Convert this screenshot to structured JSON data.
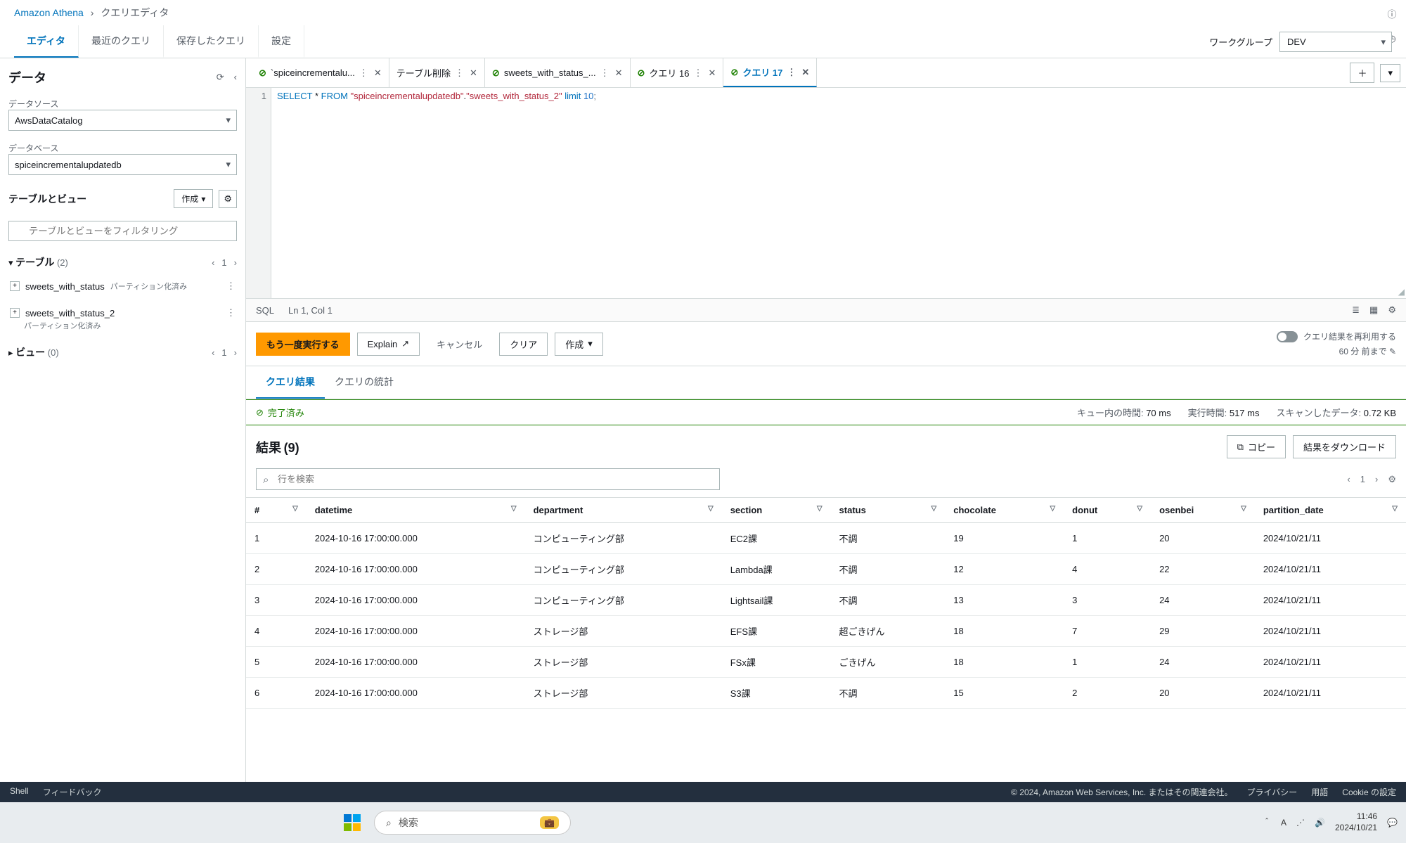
{
  "breadcrumb": {
    "service": "Amazon Athena",
    "page": "クエリエディタ"
  },
  "toptabs": {
    "editor": "エディタ",
    "recent": "最近のクエリ",
    "saved": "保存したクエリ",
    "settings": "設定"
  },
  "workgroup": {
    "label": "ワークグループ",
    "value": "DEV"
  },
  "sidebar": {
    "title": "データ",
    "datasource_label": "データソース",
    "datasource_value": "AwsDataCatalog",
    "database_label": "データベース",
    "database_value": "spiceincrementalupdatedb",
    "tv_title": "テーブルとビュー",
    "create_btn": "作成",
    "filter_placeholder": "テーブルとビューをフィルタリング",
    "tables_label": "テーブル",
    "tables_count": "(2)",
    "table_page": "1",
    "table1": "sweets_with_status",
    "table1_badge": "パーティション化済み",
    "table2": "sweets_with_status_2",
    "table2_badge": "パーティション化済み",
    "views_label": "ビュー",
    "views_count": "(0)",
    "views_page": "1"
  },
  "qtabs": {
    "t1": "`spiceincrementalu...",
    "t2": "テーブル削除",
    "t3": "sweets_with_status_...",
    "t4": "クエリ 16",
    "t5": "クエリ 17"
  },
  "editor": {
    "line": "1",
    "kw_select": "SELECT",
    "star": " * ",
    "kw_from": "FROM",
    "sp": " ",
    "str1": "\"spiceincrementalupdatedb\"",
    "dot": ".",
    "str2": "\"sweets_with_status_2\"",
    "kw_limit": " limit ",
    "num": "10",
    "semi": ";"
  },
  "statusbar": {
    "lang": "SQL",
    "pos": "Ln 1, Col 1"
  },
  "actions": {
    "run": "もう一度実行する",
    "explain": "Explain",
    "cancel": "キャンセル",
    "clear": "クリア",
    "create": "作成",
    "reuse": "クエリ結果を再利用する",
    "reuse_hint": "60 分 前まで"
  },
  "rtabs": {
    "results": "クエリ結果",
    "stats": "クエリの統計"
  },
  "done": {
    "label": "完了済み",
    "queue_lbl": "キュー内の時間:",
    "queue_val": "70 ms",
    "run_lbl": "実行時間:",
    "run_val": "517 ms",
    "scan_lbl": "スキャンしたデータ:",
    "scan_val": "0.72 KB"
  },
  "results": {
    "title": "結果",
    "count": "(9)",
    "copy": "コピー",
    "download": "結果をダウンロード",
    "search_placeholder": "行を検索",
    "page": "1",
    "columns": [
      "#",
      "datetime",
      "department",
      "section",
      "status",
      "chocolate",
      "donut",
      "osenbei",
      "partition_date"
    ],
    "rows": [
      [
        "1",
        "2024-10-16 17:00:00.000",
        "コンピューティング部",
        "EC2課",
        "不調",
        "19",
        "1",
        "20",
        "2024/10/21/11"
      ],
      [
        "2",
        "2024-10-16 17:00:00.000",
        "コンピューティング部",
        "Lambda課",
        "不調",
        "12",
        "4",
        "22",
        "2024/10/21/11"
      ],
      [
        "3",
        "2024-10-16 17:00:00.000",
        "コンピューティング部",
        "Lightsail課",
        "不調",
        "13",
        "3",
        "24",
        "2024/10/21/11"
      ],
      [
        "4",
        "2024-10-16 17:00:00.000",
        "ストレージ部",
        "EFS課",
        "超ごきげん",
        "18",
        "7",
        "29",
        "2024/10/21/11"
      ],
      [
        "5",
        "2024-10-16 17:00:00.000",
        "ストレージ部",
        "FSx課",
        "ごきげん",
        "18",
        "1",
        "24",
        "2024/10/21/11"
      ],
      [
        "6",
        "2024-10-16 17:00:00.000",
        "ストレージ部",
        "S3課",
        "不調",
        "15",
        "2",
        "20",
        "2024/10/21/11"
      ]
    ]
  },
  "footer": {
    "shell": "Shell",
    "feedback": "フィードバック",
    "copyright": "© 2024, Amazon Web Services, Inc. またはその関連会社。",
    "privacy": "プライバシー",
    "terms": "用語",
    "cookie": "Cookie の設定"
  },
  "taskbar": {
    "search": "検索",
    "time": "11:46",
    "date": "2024/10/21"
  }
}
